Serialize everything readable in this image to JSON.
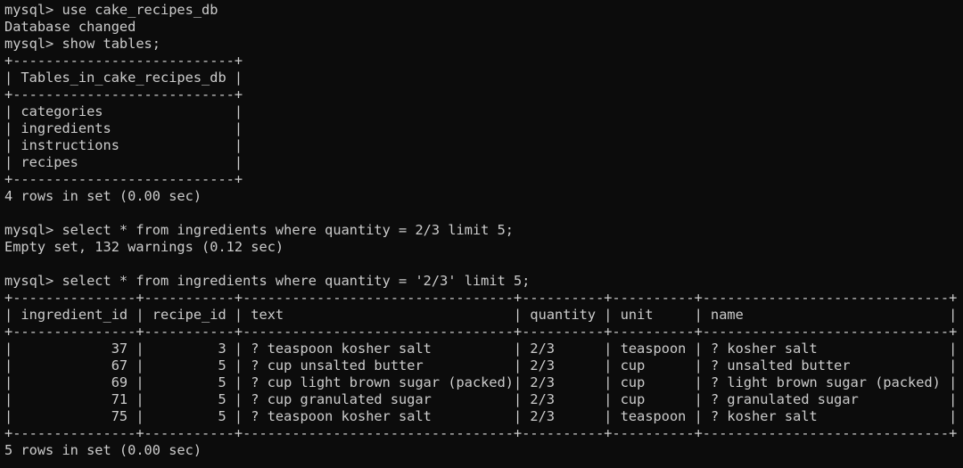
{
  "terminal": {
    "lines": [
      "mysql> use cake_recipes_db",
      "Database changed",
      "mysql> show tables;",
      "+---------------------------+",
      "| Tables_in_cake_recipes_db |",
      "+---------------------------+",
      "| categories                |",
      "| ingredients               |",
      "| instructions              |",
      "| recipes                   |",
      "+---------------------------+",
      "4 rows in set (0.00 sec)",
      "",
      "mysql> select * from ingredients where quantity = 2/3 limit 5;",
      "Empty set, 132 warnings (0.12 sec)",
      "",
      "mysql> select * from ingredients where quantity = '2/3' limit 5;",
      "+---------------+-----------+---------------------------------+----------+----------+------------------------------+",
      "| ingredient_id | recipe_id | text                            | quantity | unit     | name                         |",
      "+---------------+-----------+---------------------------------+----------+----------+------------------------------+",
      "|            37 |         3 | ? teaspoon kosher salt          | 2/3      | teaspoon | ? kosher salt                |",
      "|            67 |         5 | ? cup unsalted butter           | 2/3      | cup      | ? unsalted butter            |",
      "|            69 |         5 | ? cup light brown sugar (packed)| 2/3      | cup      | ? light brown sugar (packed) |",
      "|            71 |         5 | ? cup granulated sugar          | 2/3      | cup      | ? granulated sugar           |",
      "|            75 |         5 | ? teaspoon kosher salt          | 2/3      | teaspoon | ? kosher salt                |",
      "+---------------+-----------+---------------------------------+----------+----------+------------------------------+",
      "5 rows in set (0.00 sec)"
    ]
  },
  "colors": {
    "background": "#0c0c0c",
    "text": "#cccccc"
  }
}
